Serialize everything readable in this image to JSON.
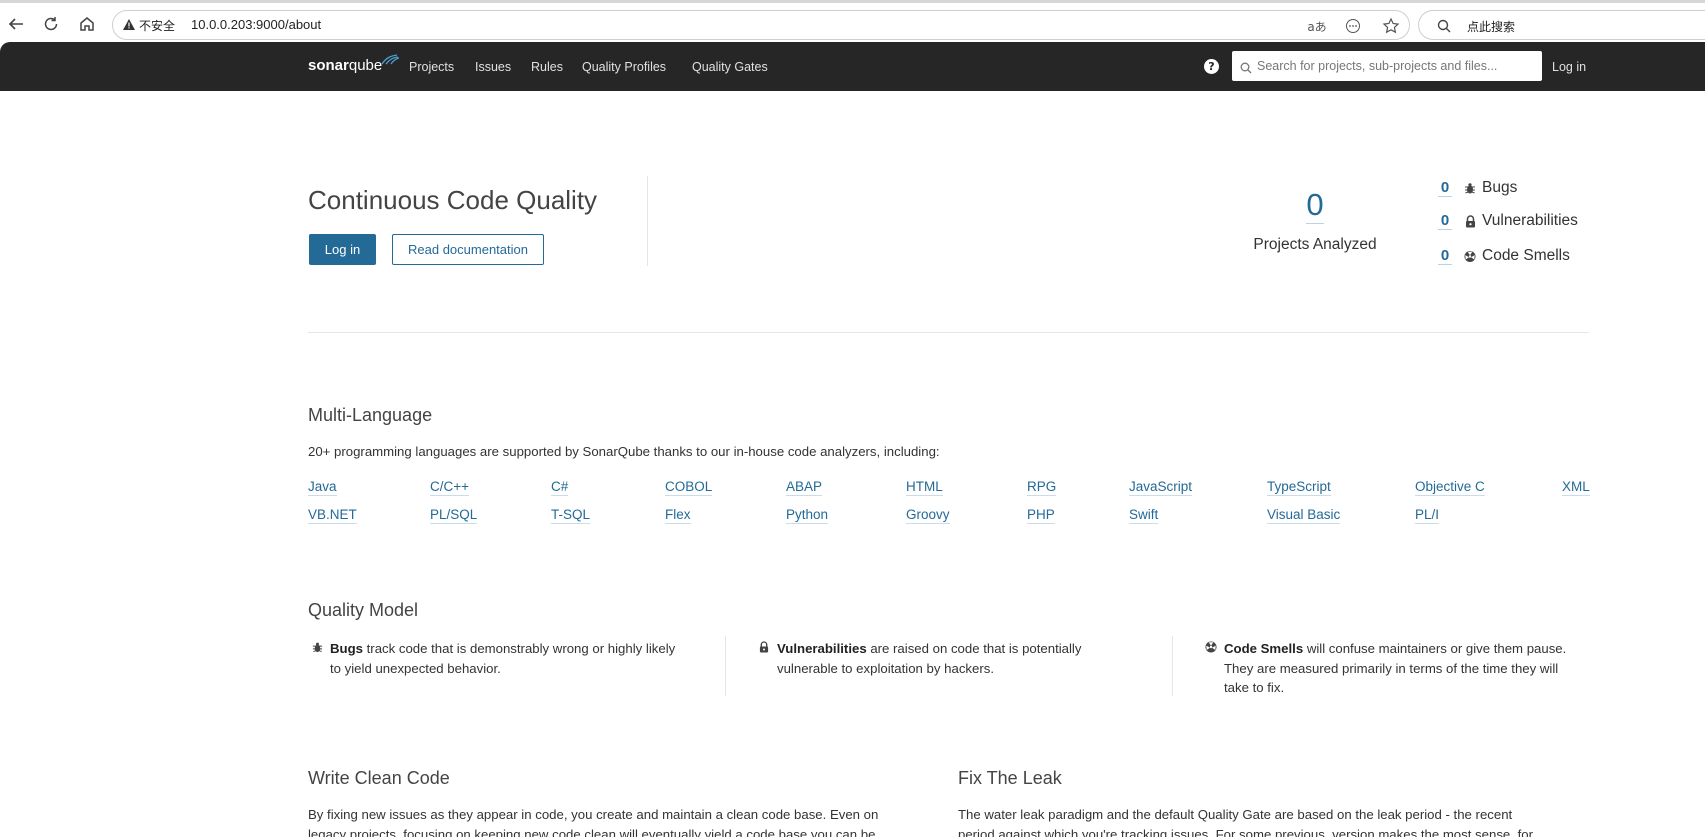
{
  "browser": {
    "security_label": "不安全",
    "url": "10.0.0.203:9000/about",
    "search_text": "点此搜索",
    "translate_label": "aあ"
  },
  "nav": {
    "logo_bold": "sonar",
    "logo_light": "qube",
    "items": [
      "Projects",
      "Issues",
      "Rules",
      "Quality Profiles",
      "Quality Gates"
    ],
    "search_placeholder": "Search for projects, sub-projects and files...",
    "login": "Log in",
    "help": "?"
  },
  "hero": {
    "title": "Continuous Code Quality",
    "login_button": "Log in",
    "docs_button": "Read documentation",
    "projects_count": "0",
    "projects_label": "Projects Analyzed",
    "stats": [
      {
        "value": "0",
        "label": "Bugs",
        "icon": "bug-icon"
      },
      {
        "value": "0",
        "label": "Vulnerabilities",
        "icon": "lock-icon"
      },
      {
        "value": "0",
        "label": "Code Smells",
        "icon": "code-smell-icon"
      }
    ]
  },
  "multi_language": {
    "title": "Multi-Language",
    "text": "20+ programming languages are supported by SonarQube thanks to our in-house code analyzers, including:",
    "row1": [
      "Java",
      "C/C++",
      "C#",
      "COBOL",
      "ABAP",
      "HTML",
      "RPG",
      "JavaScript",
      "TypeScript",
      "Objective C",
      "XML"
    ],
    "row2": [
      "VB.NET",
      "PL/SQL",
      "T-SQL",
      "Flex",
      "Python",
      "Groovy",
      "PHP",
      "Swift",
      "Visual Basic",
      "PL/I"
    ]
  },
  "quality_model": {
    "title": "Quality Model",
    "items": [
      {
        "bold": "Bugs",
        "line1": " track code that is demonstrably wrong or highly likely",
        "line2": "to yield unexpected behavior.",
        "line3": ""
      },
      {
        "bold": "Vulnerabilities",
        "line1": " are raised on code that is potentially",
        "line2": "vulnerable to exploitation by hackers.",
        "line3": ""
      },
      {
        "bold": "Code Smells",
        "line1": " will confuse maintainers or give them pause.",
        "line2": "They are measured primarily in terms of the time they will",
        "line3": "take to fix."
      }
    ]
  },
  "clean_code": {
    "title": "Write Clean Code",
    "line1": "By fixing new issues as they appear in code, you create and maintain a clean code base. Even on",
    "line2": "legacy projects, focusing on keeping new code clean will eventually yield a code base you can be"
  },
  "fix_leak": {
    "title": "Fix The Leak",
    "line1": "The water leak paradigm and the default Quality Gate are based on the leak period - the recent",
    "line2": "period against which you're tracking issues. For some previous_version makes the most sense, for"
  }
}
